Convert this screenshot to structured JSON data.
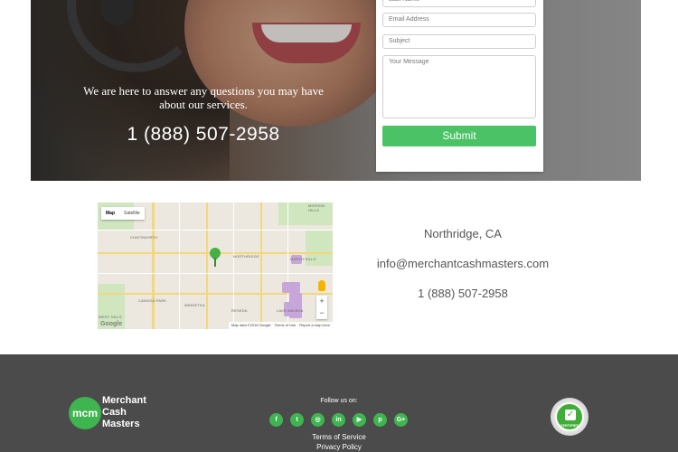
{
  "hero": {
    "message": "We are here to answer any questions you may have about our services.",
    "phone": "1 (888) 507-2958"
  },
  "form": {
    "name_placeholder": "Last Name",
    "email_placeholder": "Email Address",
    "subject_placeholder": "Subject",
    "message_placeholder": "Your Message",
    "submit_label": "Submit"
  },
  "map": {
    "map_label": "Map",
    "satellite_label": "Satellite",
    "places": [
      "MISSION HILLS",
      "CHATSWORTH",
      "NORTHRIDGE",
      "NORTH HILLS",
      "CANOGA PARK",
      "WINNETKA",
      "RESEDA",
      "LAKE BALBOA",
      "WEST HILLS"
    ],
    "zoom_in": "+",
    "zoom_out": "−",
    "attribution": "Map data ©2018 Google",
    "terms": "Terms of Use",
    "report": "Report a map error",
    "brand": "Google"
  },
  "contact": {
    "location": "Northridge, CA",
    "email": "info@merchantcashmasters.com",
    "phone": "1 (888) 507-2958"
  },
  "footer": {
    "logo_mark": "mcm",
    "logo_lines": [
      "Merchant",
      "Cash",
      "Masters"
    ],
    "follow_label": "Follow us on:",
    "socials": [
      {
        "icon": "facebook-icon",
        "glyph": "f"
      },
      {
        "icon": "twitter-icon",
        "glyph": "t"
      },
      {
        "icon": "instagram-icon",
        "glyph": "◎"
      },
      {
        "icon": "linkedin-icon",
        "glyph": "in"
      },
      {
        "icon": "youtube-icon",
        "glyph": "▶"
      },
      {
        "icon": "pinterest-icon",
        "glyph": "p"
      },
      {
        "icon": "google-plus-icon",
        "glyph": "G+"
      }
    ],
    "terms_link": "Terms of Service",
    "privacy_link": "Privacy Policy",
    "badge_text": "CERTIFIED"
  },
  "colors": {
    "accent": "#4cc266",
    "footer_bg": "#4b4b4b"
  }
}
